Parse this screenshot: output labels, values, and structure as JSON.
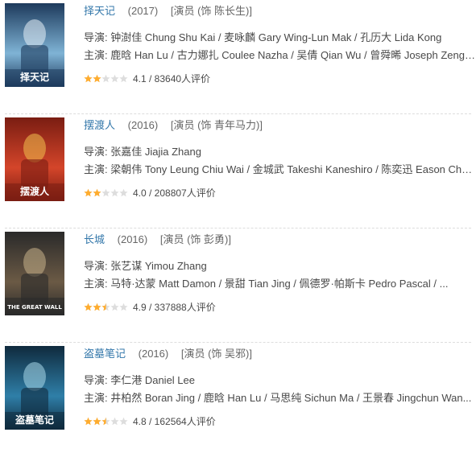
{
  "items": [
    {
      "title": "择天记",
      "year": "(2017)",
      "role": "[演员 (饰 陈长生)]",
      "director": "导演: 钟澍佳 Chung Shu Kai / 麦咏麟 Gary Wing-Lun Mak / 孔历大 Lida Kong",
      "cast": "主演: 鹿晗 Han Lu / 古力娜扎 Coulee Nazha / 吴倩 Qian Wu / 曾舜晞 Joseph Zeng / ...",
      "rating_text": "4.1 / 83640人评价",
      "rating_value": 4.1,
      "poster_label": "择天记",
      "poster_colors": [
        "#1d3a5c",
        "#7fb3d5",
        "#e8f1f7"
      ]
    },
    {
      "title": "摆渡人",
      "year": "(2016)",
      "role": "[演员 (饰 青年马力)]",
      "director": "导演: 张嘉佳 Jiajia Zhang",
      "cast": "主演: 梁朝伟 Tony Leung Chiu Wai / 金城武 Takeshi Kaneshiro / 陈奕迅 Eason Cha...",
      "rating_text": "4.0 / 208807人评价",
      "rating_value": 4.0,
      "poster_label": "摆渡人",
      "poster_colors": [
        "#7a1d12",
        "#d4452a",
        "#f2c14e"
      ]
    },
    {
      "title": "长城",
      "year": "(2016)",
      "role": "[演员 (饰 彭勇)]",
      "director": "导演: 张艺谋 Yimou Zhang",
      "cast": "主演: 马特·达蒙 Matt Damon / 景甜 Tian Jing / 佩德罗·帕斯卡 Pedro Pascal / ...",
      "rating_text": "4.9 / 337888人评价",
      "rating_value": 4.9,
      "poster_label": "THE GREAT WALL",
      "poster_colors": [
        "#2a2a2a",
        "#6b5a45",
        "#c9b28a"
      ]
    },
    {
      "title": "盗墓笔记",
      "year": "(2016)",
      "role": "[演员 (饰 吴邪)]",
      "director": "导演: 李仁港 Daniel Lee",
      "cast": "主演: 井柏然 Boran Jing / 鹿晗 Han Lu / 马思纯 Sichun Ma / 王景春 Jingchun Wan...",
      "rating_text": "4.8 / 162564人评价",
      "rating_value": 4.8,
      "poster_label": "盗墓笔记",
      "poster_colors": [
        "#0f2a3d",
        "#2f7fa8",
        "#a9d8ea"
      ]
    }
  ],
  "colors": {
    "link": "#3377aa",
    "star_on": "#ffac2d",
    "star_off": "#dddddd"
  }
}
